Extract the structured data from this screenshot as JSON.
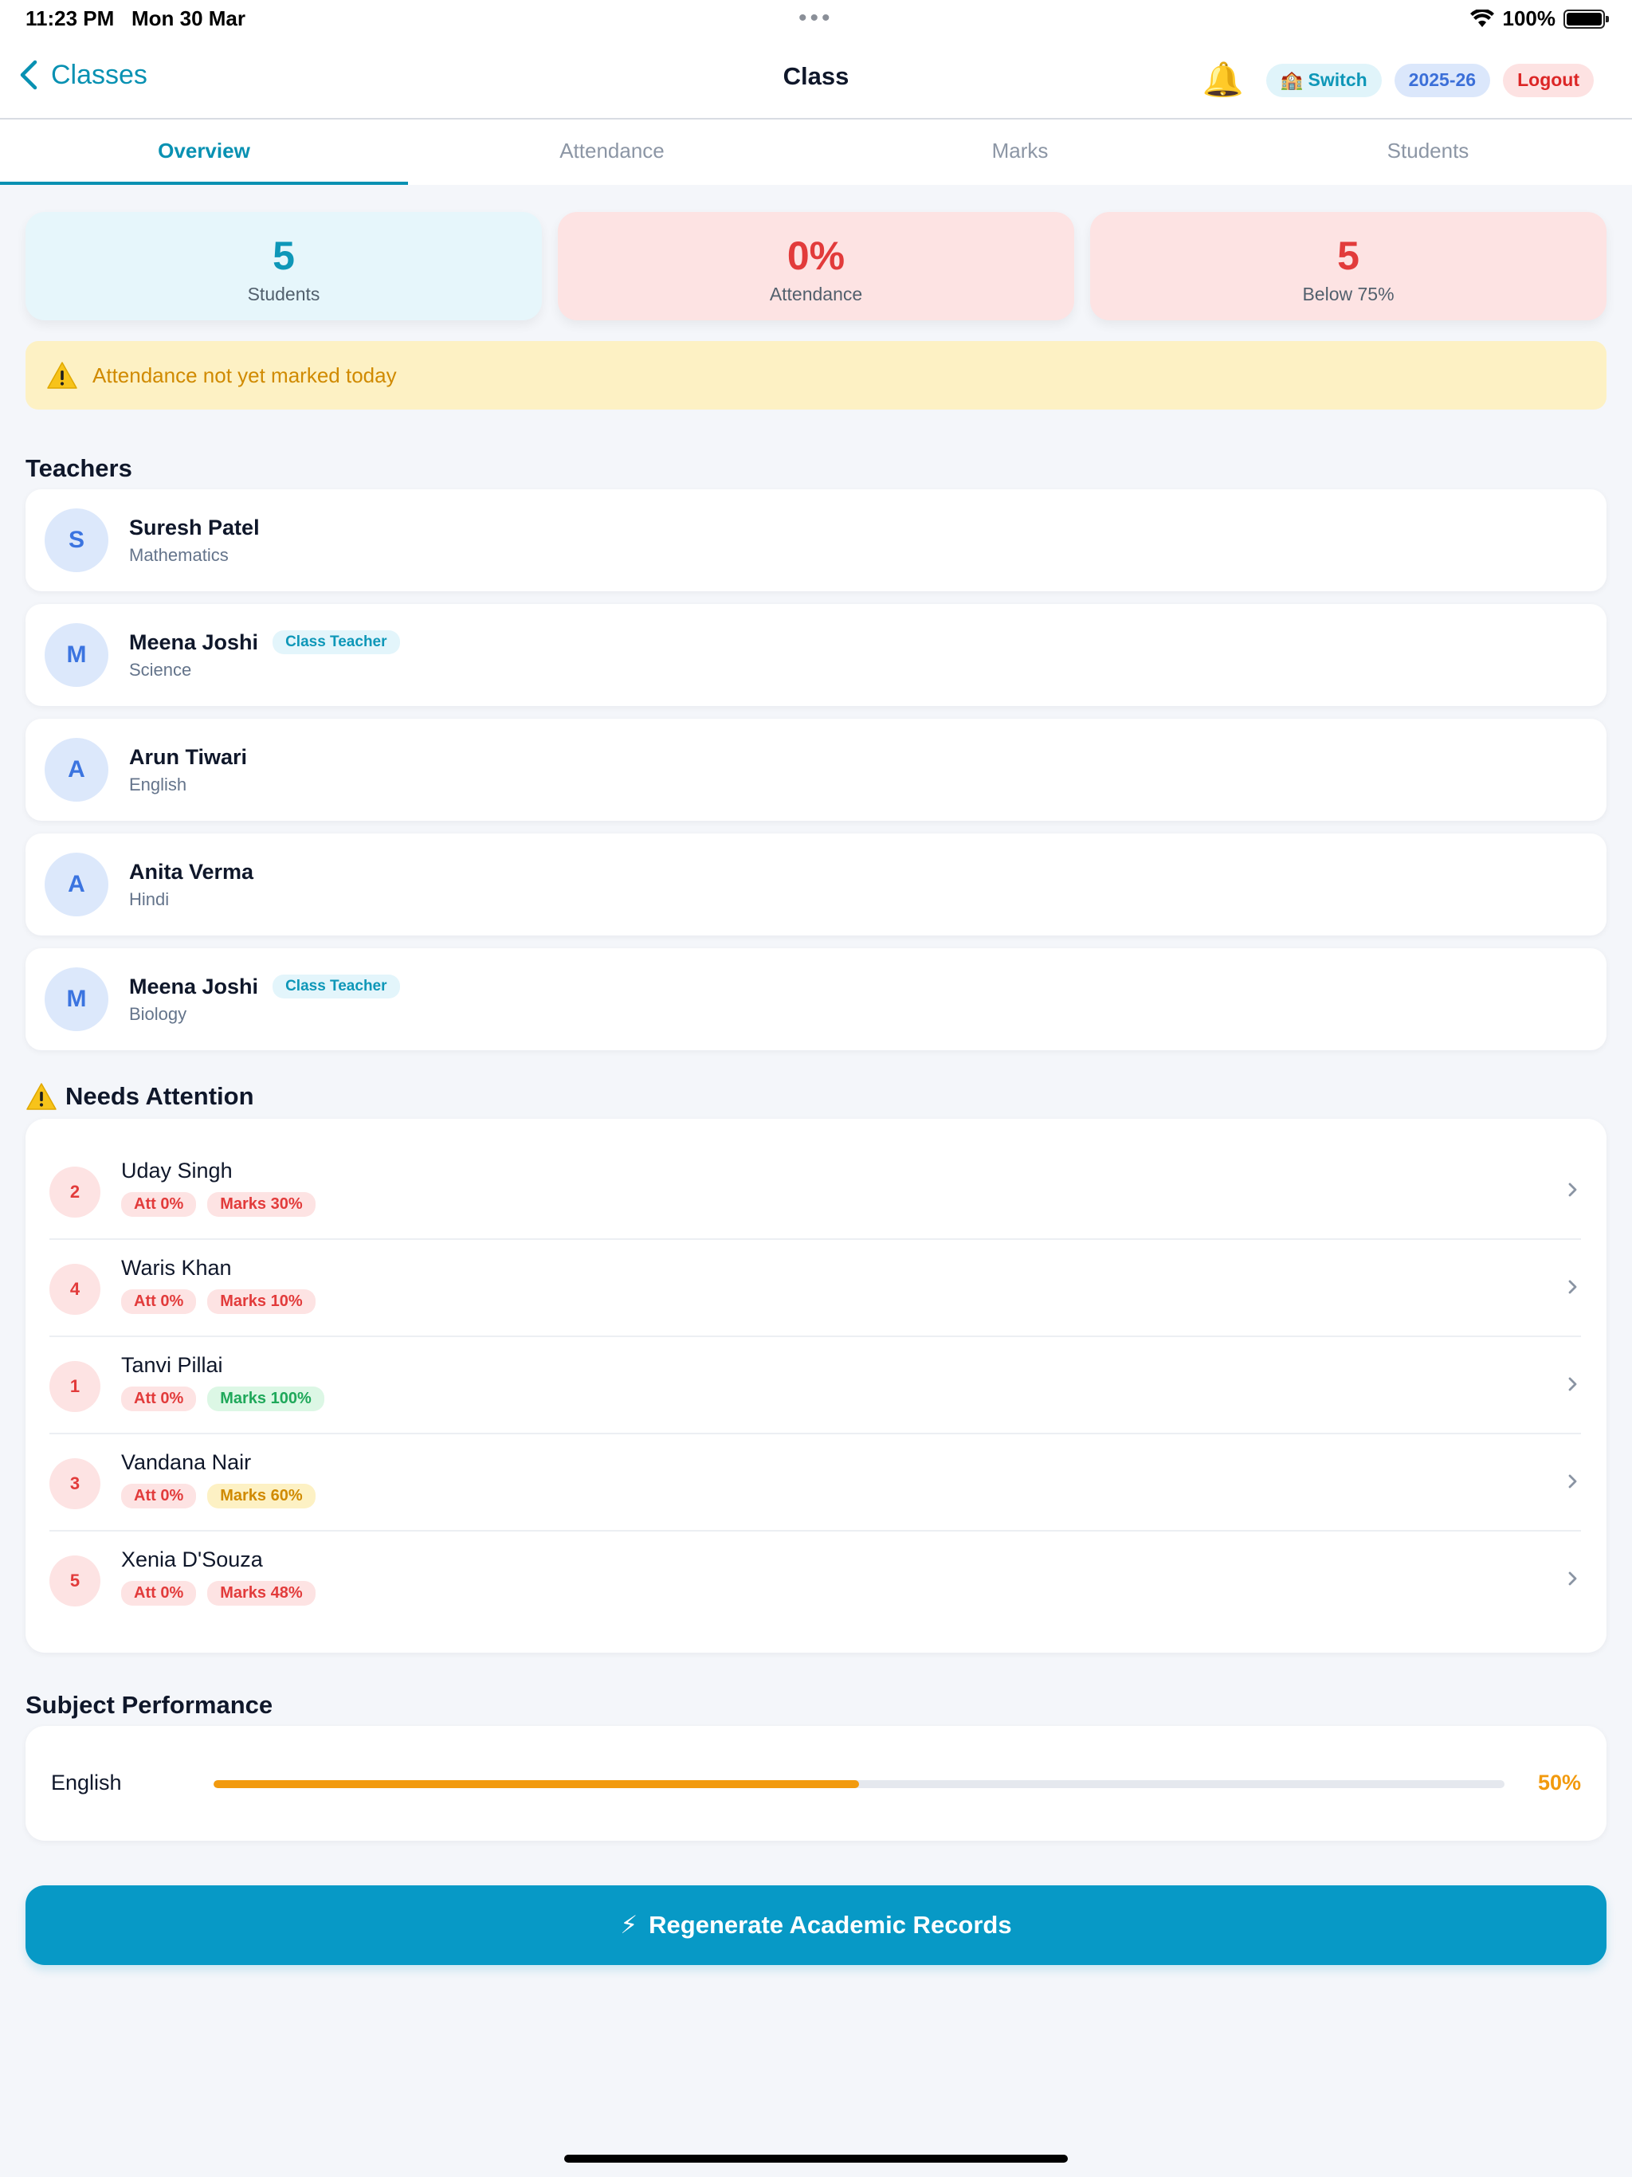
{
  "status_bar": {
    "time": "11:23 PM",
    "date": "Mon 30 Mar",
    "battery": "100%"
  },
  "nav": {
    "back_label": "Classes",
    "title": "Class",
    "switch_label": "Switch",
    "year_label": "2025-26",
    "logout_label": "Logout"
  },
  "tabs": [
    {
      "label": "Overview",
      "active": true
    },
    {
      "label": "Attendance",
      "active": false
    },
    {
      "label": "Marks",
      "active": false
    },
    {
      "label": "Students",
      "active": false
    }
  ],
  "stats": [
    {
      "value": "5",
      "label": "Students",
      "color": "#0e97b8"
    },
    {
      "value": "0%",
      "label": "Attendance",
      "color": "#e23b3b"
    },
    {
      "value": "5",
      "label": "Below 75%",
      "color": "#e23b3b"
    }
  ],
  "warning": {
    "text": "Attendance not yet marked today"
  },
  "teachers_section": {
    "title": "Teachers"
  },
  "teachers": [
    {
      "initial": "S",
      "name": "Suresh Patel",
      "subject": "Mathematics",
      "badge": ""
    },
    {
      "initial": "M",
      "name": "Meena Joshi",
      "subject": "Science",
      "badge": "Class Teacher"
    },
    {
      "initial": "A",
      "name": "Arun Tiwari",
      "subject": "English",
      "badge": ""
    },
    {
      "initial": "A",
      "name": "Anita Verma",
      "subject": "Hindi",
      "badge": ""
    },
    {
      "initial": "M",
      "name": "Meena Joshi",
      "subject": "Biology",
      "badge": "Class Teacher"
    }
  ],
  "attention_section": {
    "title": "Needs Attention"
  },
  "attention": [
    {
      "rank": "2",
      "name": "Uday Singh",
      "att": "Att 0%",
      "marks": "Marks 30%",
      "marks_level": "red"
    },
    {
      "rank": "4",
      "name": "Waris Khan",
      "att": "Att 0%",
      "marks": "Marks 10%",
      "marks_level": "red"
    },
    {
      "rank": "1",
      "name": "Tanvi Pillai",
      "att": "Att 0%",
      "marks": "Marks 100%",
      "marks_level": "green"
    },
    {
      "rank": "3",
      "name": "Vandana Nair",
      "att": "Att 0%",
      "marks": "Marks 60%",
      "marks_level": "yellow"
    },
    {
      "rank": "5",
      "name": "Xenia D'Souza",
      "att": "Att 0%",
      "marks": "Marks 48%",
      "marks_level": "red"
    }
  ],
  "performance_section": {
    "title": "Subject Performance"
  },
  "performance": [
    {
      "subject": "English",
      "percent_label": "50%",
      "fraction": 0.5,
      "color": "#f29a0e"
    }
  ],
  "regenerate": {
    "label": "Regenerate Academic Records"
  },
  "icons": {
    "back": "chevron-left-icon",
    "bell": "bell-icon",
    "school": "school-icon",
    "warning": "warning-icon",
    "chevron": "chevron-right-icon",
    "bolt": "lightning-icon"
  }
}
